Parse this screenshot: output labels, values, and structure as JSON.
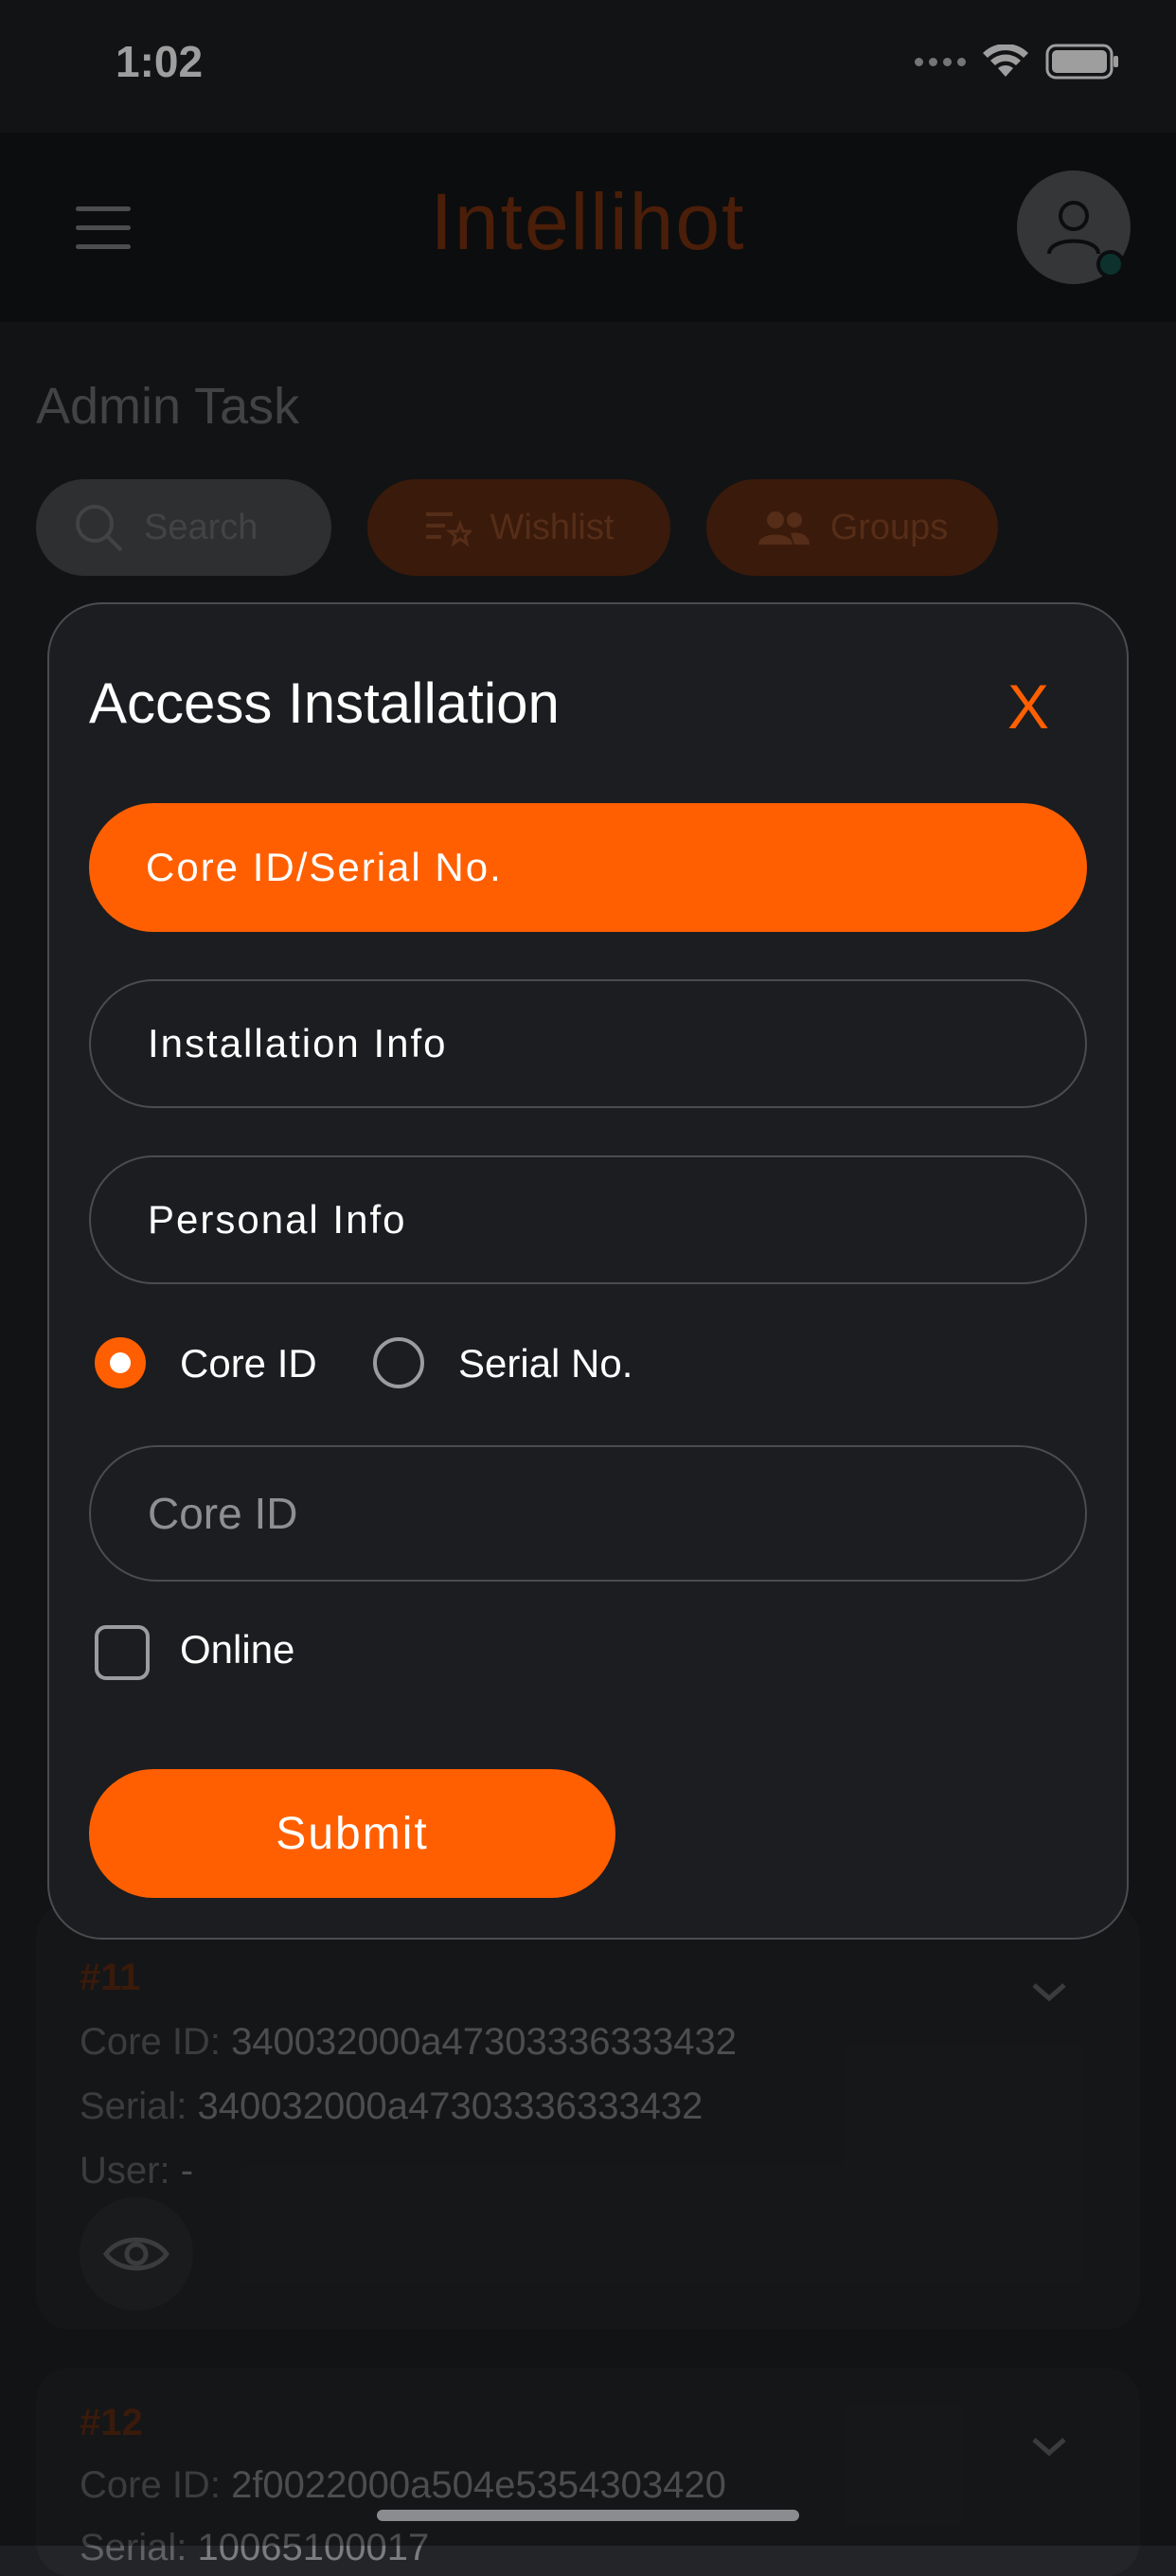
{
  "status": {
    "time": "1:02"
  },
  "header": {
    "brand": "Intellihot"
  },
  "page": {
    "title": "Admin Task",
    "search_label": "Search",
    "wishlist_label": "Wishlist",
    "groups_label": "Groups"
  },
  "cards": [
    {
      "num": "#11",
      "core_label": "Core ID:",
      "core_value": "340032000a47303336333432",
      "serial_label": "Serial:",
      "serial_value": "340032000a47303336333432",
      "user_label": "User:",
      "user_value": "-"
    },
    {
      "num": "#12",
      "core_label": "Core ID:",
      "core_value": "2f0022000a504e5354303420",
      "serial_label": "Serial:",
      "serial_value": "10065100017"
    }
  ],
  "modal": {
    "title": "Access Installation",
    "close_label": "X",
    "tabs": [
      "Core ID/Serial No.",
      "Installation Info",
      "Personal Info"
    ],
    "radio_core": "Core ID",
    "radio_serial": "Serial No.",
    "input_placeholder": "Core ID",
    "checkbox_label": "Online",
    "submit_label": "Submit"
  },
  "colors": {
    "accent": "#ff5f00",
    "background": "#1d1f22",
    "modal": "#1b1d20"
  }
}
